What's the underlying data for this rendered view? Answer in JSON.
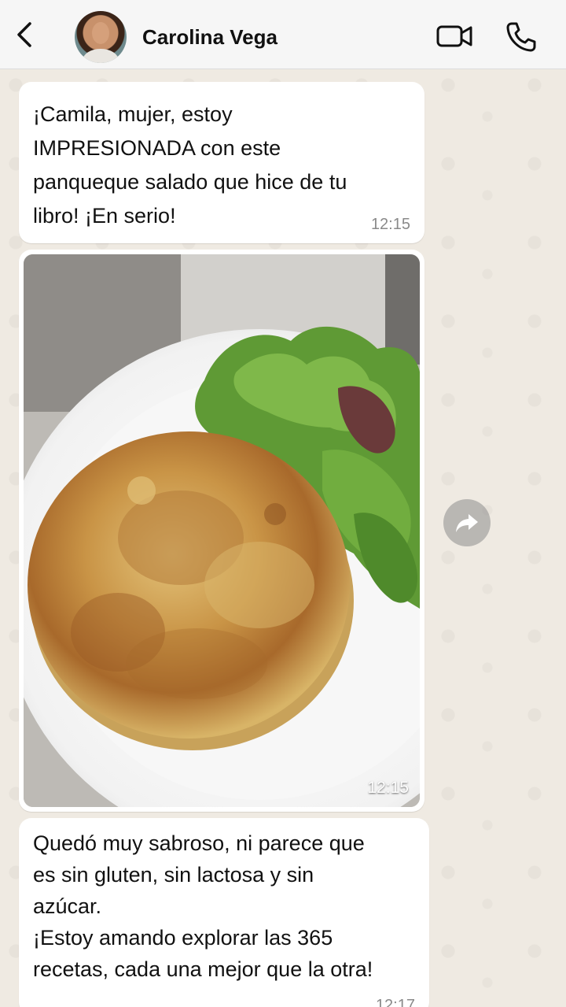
{
  "header": {
    "contact_name": "Carolina Vega",
    "back_icon": "chevron-left-icon",
    "video_icon": "video-camera-icon",
    "call_icon": "phone-icon"
  },
  "messages": [
    {
      "type": "text",
      "text": "¡Camila, mujer, estoy\nIMPRESIONADA con este\npanqueque salado que hice de tu\nlibro! ¡En serio!",
      "time": "12:15"
    },
    {
      "type": "image",
      "image_description": "savory pancake on white plate with green salad",
      "time": "12:15"
    },
    {
      "type": "text",
      "text": "Quedó muy sabroso, ni parece que\nes sin gluten, sin lactosa y sin\nazúcar.\n¡Estoy amando explorar las 365\nrecetas, cada una mejor que la otra!",
      "time": "12:17"
    }
  ],
  "colors": {
    "header_bg": "#f6f6f6",
    "chat_bg": "#efeae2",
    "bubble_bg": "#ffffff",
    "time_color": "#8a8a8a"
  }
}
